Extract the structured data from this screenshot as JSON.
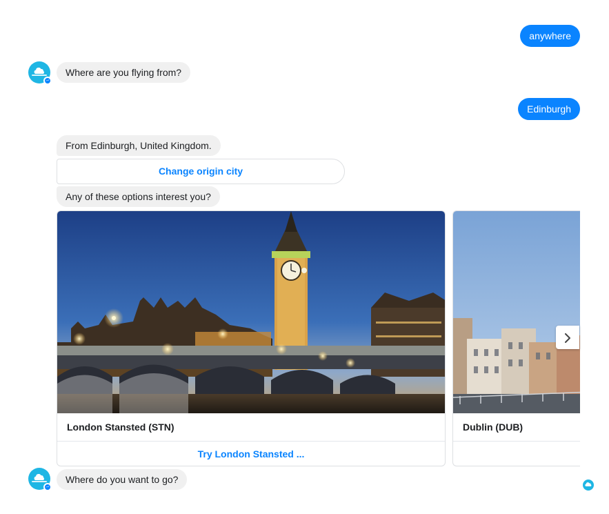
{
  "colors": {
    "accent": "#0a84ff",
    "incoming_bubble": "#f0f0f0",
    "bot_avatar": "#1fb6e4"
  },
  "messages": {
    "user_1": "anywhere",
    "bot_1": "Where are you flying from?",
    "user_2": "Edinburgh",
    "bot_2": "From Edinburgh, United Kingdom.",
    "quick_reply": "Change origin city",
    "bot_3": "Any of these options interest you?",
    "bot_4": "Where do you want to go?"
  },
  "carousel": {
    "cards": [
      {
        "title": "London Stansted (STN)",
        "button": "Try London Stansted ...",
        "image": "london-big-ben-night-photo"
      },
      {
        "title": "Dublin (DUB)",
        "button": "",
        "image": "dublin-riverside-photo"
      }
    ],
    "next_icon": "chevron-right-icon"
  },
  "icons": {
    "bot_avatar": "skyscanner-cloud-logo-icon",
    "messenger_badge": "messenger-badge-icon",
    "seen_indicator": "seen-avatar-icon"
  }
}
